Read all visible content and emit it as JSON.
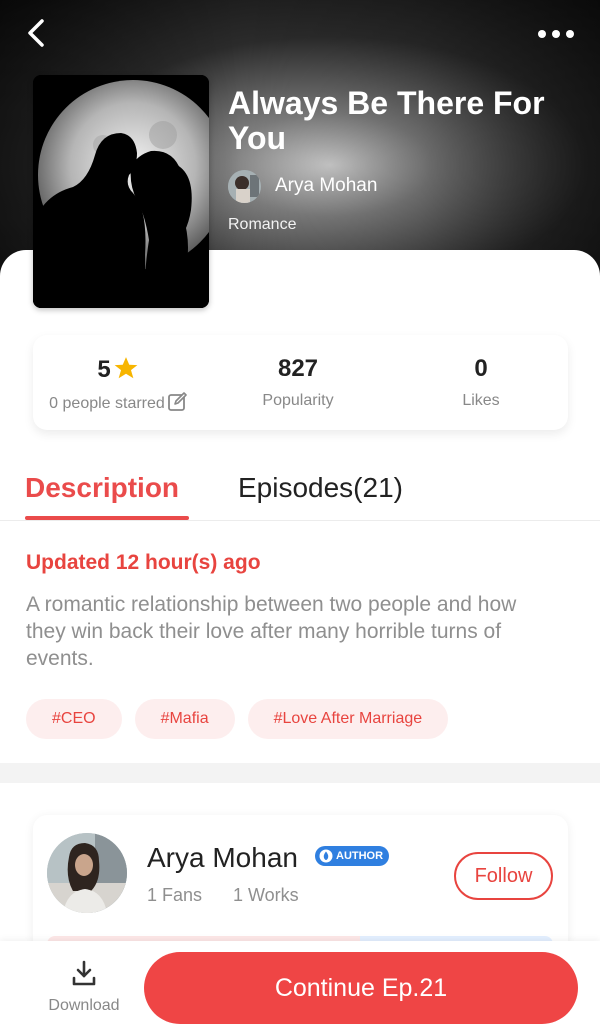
{
  "book": {
    "title": "Always Be There For You",
    "author": "Arya Mohan",
    "genre": "Romance"
  },
  "stats": {
    "rating": "5",
    "rating_label": "0 people starred",
    "popularity": "827",
    "popularity_label": "Popularity",
    "likes": "0",
    "likes_label": "Likes"
  },
  "tabs": {
    "description": "Description",
    "episodes": "Episodes(21)"
  },
  "description": {
    "updated": "Updated 12 hour(s) ago",
    "text": "A romantic relationship between two people and how they win back their love after many horrible turns of events.",
    "tags": [
      "#CEO",
      "#Mafia",
      "#Love After Marriage"
    ]
  },
  "author_card": {
    "name": "Arya Mohan",
    "badge": "AUTHOR",
    "fans": "1 Fans",
    "works": "1 Works",
    "follow": "Follow"
  },
  "bottom_bar": {
    "download": "Download",
    "continue": "Continue Ep.21"
  },
  "colors": {
    "accent": "#ea4b4b",
    "button": "#ef4545",
    "badge": "#2f7fe0",
    "star": "#f7b500"
  },
  "icons": {
    "back": "chevron-left-icon",
    "more": "more-horizontal-icon",
    "star": "star-icon",
    "edit": "edit-icon",
    "badge": "author-badge-icon",
    "download": "download-icon"
  }
}
